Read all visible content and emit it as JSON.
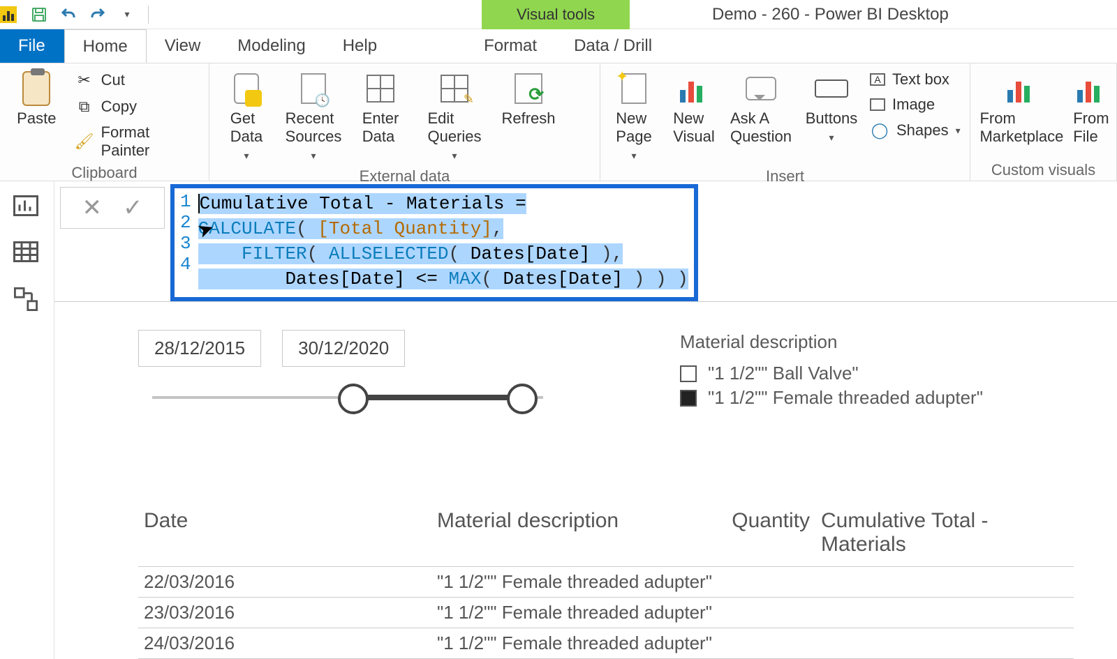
{
  "app": {
    "visual_tools": "Visual tools",
    "title": "Demo - 260 - Power BI Desktop"
  },
  "tabs": {
    "file": "File",
    "home": "Home",
    "view": "View",
    "modeling": "Modeling",
    "help": "Help",
    "format": "Format",
    "data_drill": "Data / Drill"
  },
  "ribbon": {
    "clipboard": {
      "paste": "Paste",
      "cut": "Cut",
      "copy": "Copy",
      "format_painter": "Format Painter",
      "group": "Clipboard"
    },
    "external": {
      "get_data": "Get\nData",
      "recent_sources": "Recent\nSources",
      "enter_data": "Enter\nData",
      "edit_queries": "Edit\nQueries",
      "refresh": "Refresh",
      "group": "External data"
    },
    "insert": {
      "new_page": "New\nPage",
      "new_visual": "New\nVisual",
      "ask": "Ask A\nQuestion",
      "buttons": "Buttons",
      "text_box": "Text box",
      "image": "Image",
      "shapes": "Shapes",
      "group": "Insert"
    },
    "custom": {
      "marketplace": "From\nMarketplace",
      "file": "From\nFile",
      "group": "Custom visuals"
    }
  },
  "formula": {
    "lines": [
      "1",
      "2",
      "3",
      "4"
    ],
    "l1": "Cumulative Total - Materials =",
    "l2a": "CALCULATE",
    "l2b": "( ",
    "l2c": "[Total Quantity]",
    "l2d": ",",
    "l3a": "FILTER",
    "l3b": "( ",
    "l3c": "ALLSELECTED",
    "l3d": "( ",
    "l3e": "Dates[Date]",
    "l3f": " ),",
    "l4a": "Dates[Date]",
    "l4b": " <= ",
    "l4c": "MAX",
    "l4d": "( ",
    "l4e": "Dates[Date]",
    "l4f": " ) ) )"
  },
  "slicer": {
    "start": "28/12/2015",
    "end": "30/12/2020"
  },
  "legend": {
    "title": "Material description",
    "items": [
      {
        "label": "\"1 1/2\"\" Ball Valve\"",
        "checked": false
      },
      {
        "label": "\"1 1/2\"\" Female threaded adupter\"",
        "checked": true
      }
    ]
  },
  "table": {
    "headers": {
      "c1": "Date",
      "c2": "Material description",
      "c3": "Quantity",
      "c4": "Cumulative Total - Materials"
    },
    "rows": [
      {
        "c1": "22/03/2016",
        "c2": "\"1 1/2\"\" Female threaded adupter\"",
        "faded": true
      },
      {
        "c1": "23/03/2016",
        "c2": "\"1 1/2\"\" Female threaded adupter\"",
        "faded": false
      },
      {
        "c1": "24/03/2016",
        "c2": "\"1 1/2\"\" Female threaded adupter\"",
        "faded": false
      }
    ]
  }
}
